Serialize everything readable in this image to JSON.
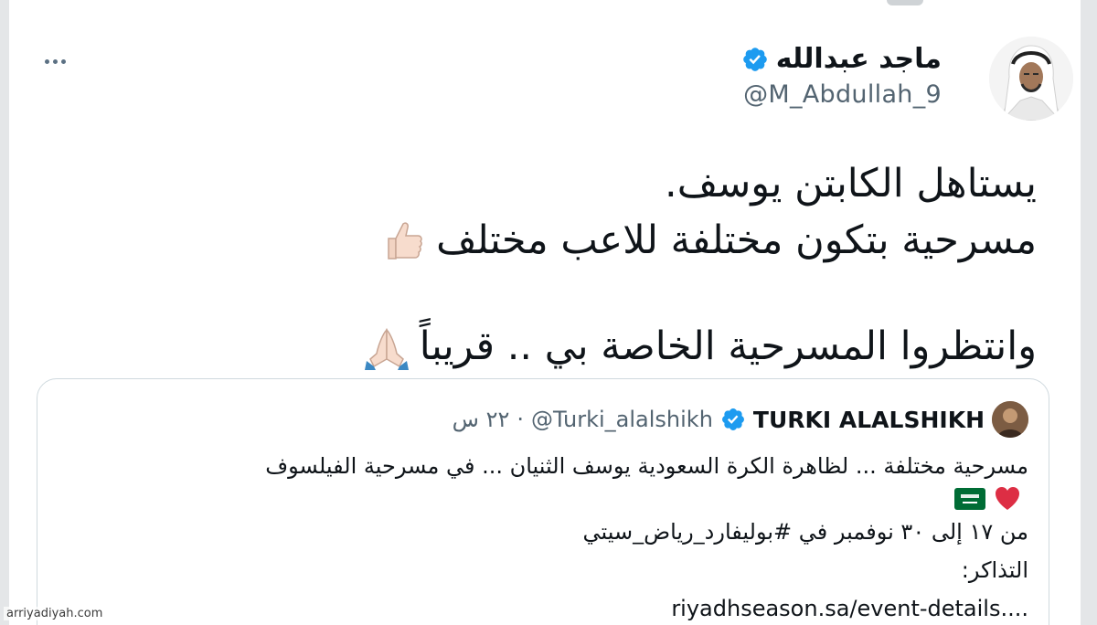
{
  "tweet": {
    "author": {
      "name": "ماجد عبدالله",
      "handle": "@M_Abdullah_9",
      "verified": true,
      "avatar_icon": "profile-photo-man-ghutra"
    },
    "more_icon": "more-horizontal-icon",
    "lines": [
      "يستاهل الكابتن يوسف.",
      "مسرحية بتكون مختلفة للاعب مختلف",
      "",
      "وانتظروا المسرحية الخاصة بي .. قريباً"
    ],
    "emojis": {
      "line2": "thumbs-up-emoji",
      "line4": "folded-hands-emoji"
    }
  },
  "quoted_tweet": {
    "author_name": "TURKI ALALSHIKH",
    "verified": true,
    "handle": "@Turki_alalshikh",
    "separator": "·",
    "time": "٢٢ س",
    "body_lines": [
      "مسرحية مختلفة  ... لظاهرة الكرة السعودية يوسف الثنيان ... في مسرحية الفيلسوف",
      "",
      "من ١٧ إلى ٣٠ نوفمبر في #بوليفارد_رياض_سيتي",
      "التذاكر:",
      "riyadhseason.sa/event-details...."
    ],
    "emojis_line2": [
      "red-heart-emoji",
      "saudi-flag-emoji"
    ]
  },
  "watermark": "arriyadiyah.com",
  "colors": {
    "verified_blue": "#1d9bf0",
    "text_primary": "#0f1419",
    "text_secondary": "#536471",
    "border": "#cfd9de"
  }
}
